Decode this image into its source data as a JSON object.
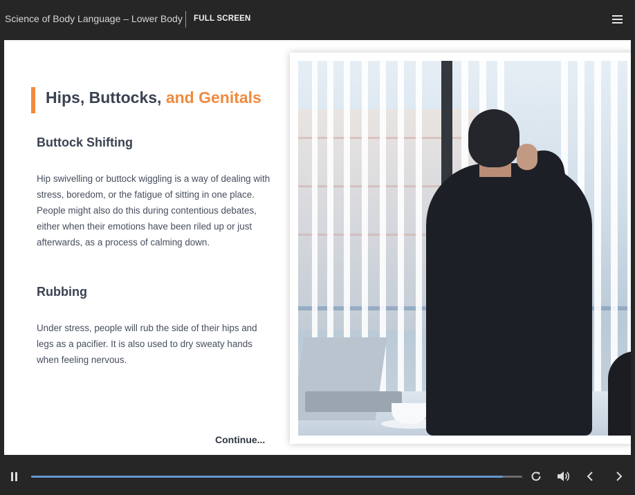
{
  "header": {
    "course_title": "Science of Body Language – Lower Body",
    "fullscreen_label": "FULL SCREEN"
  },
  "slide": {
    "heading_part1": "Hips, Buttocks, ",
    "heading_part2": "and Genitals",
    "section1_title": "Buttock Shifting",
    "section1_body": "Hip swivelling or buttock wiggling is a way of dealing with stress, boredom, or the fatigue of sitting in one place. People might also do this during contentious debates, either when their emotions have been riled up or just afterwards, as a process of calming down.",
    "section2_title": "Rubbing",
    "section2_body": "Under stress, people will rub the side of their hips and legs as a pacifier. It is also used to dry sweaty hands when feeling nervous.",
    "continue_label": "Continue..."
  },
  "player": {
    "progress_fraction": 0.96
  },
  "colors": {
    "accent": "#f08a3e",
    "heading": "#3a4252",
    "progress": "#6796cf",
    "chrome": "#262626"
  },
  "icons": [
    "menu-icon",
    "pause-icon",
    "replay-icon",
    "volume-icon",
    "chevron-left-icon",
    "chevron-right-icon"
  ]
}
